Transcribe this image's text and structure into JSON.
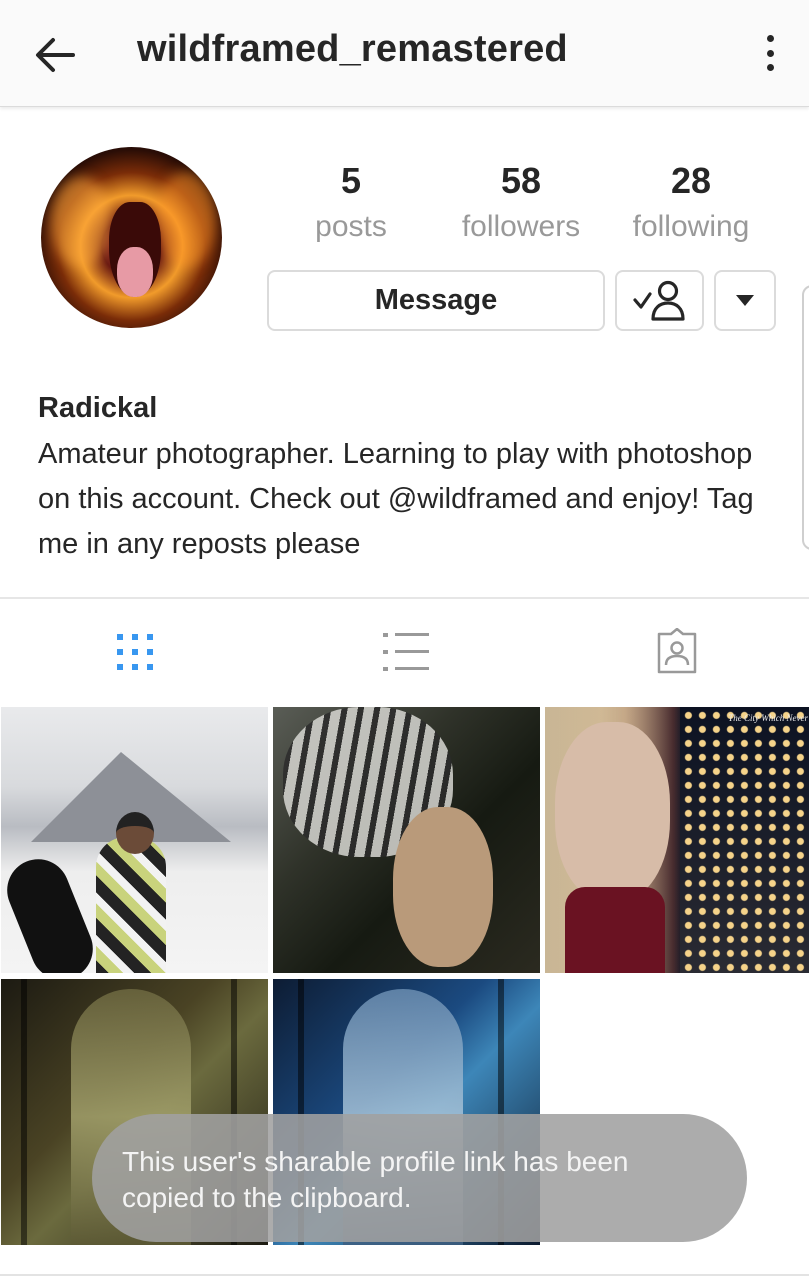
{
  "header": {
    "username": "wildframed_remastered"
  },
  "stats": [
    {
      "value": "5",
      "label": "posts"
    },
    {
      "value": "58",
      "label": "followers"
    },
    {
      "value": "28",
      "label": "following"
    }
  ],
  "actions": {
    "message_label": "Message"
  },
  "bio": {
    "name": "Radickal",
    "text": "Amateur photographer. Learning to play with photoshop on this account. Check out @wildframed and enjoy! Tag me in any reposts please"
  },
  "tabs": {
    "grid_icon": "grid-icon",
    "list_icon": "list-icon",
    "tagged_icon": "tagged-icon",
    "active": "grid",
    "active_color": "#3897f0",
    "inactive_color": "#999999"
  },
  "posts": {
    "count_visible": 5,
    "p3_caption": "The City Which Never"
  },
  "toast": {
    "message": "This user's sharable profile link has been copied to the clipboard."
  }
}
